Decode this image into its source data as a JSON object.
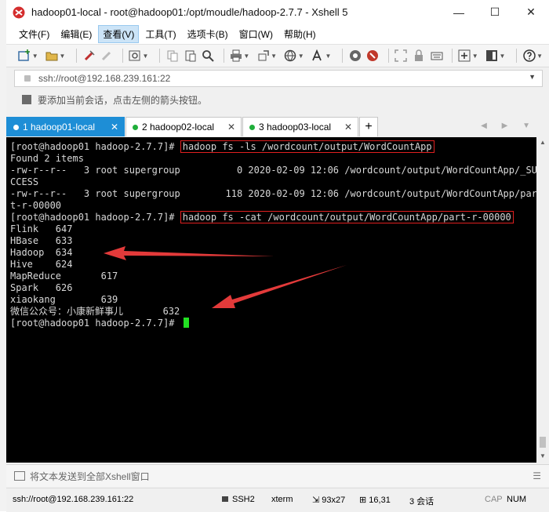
{
  "window": {
    "title": "hadoop01-local - root@hadoop01:/opt/moudle/hadoop-2.7.7 - Xshell 5"
  },
  "menu": [
    "文件(F)",
    "编辑(E)",
    "查看(V)",
    "工具(T)",
    "选项卡(B)",
    "窗口(W)",
    "帮助(H)"
  ],
  "address": {
    "value": "ssh://root@192.168.239.161:22"
  },
  "hint": {
    "text": "要添加当前会话，点击左侧的箭头按钮。"
  },
  "tabs": [
    {
      "label": "1 hadoop01-local",
      "active": true
    },
    {
      "label": "2 hadoop02-local",
      "active": false
    },
    {
      "label": "3 hadoop03-local",
      "active": false
    }
  ],
  "terminal": {
    "lines": [
      {
        "prompt": "[root@hadoop01 hadoop-2.7.7]# ",
        "cmd": "hadoop fs -ls /wordcount/output/WordCountApp"
      },
      {
        "text": "Found 2 items"
      },
      {
        "text": "-rw-r--r--   3 root supergroup          0 2020-02-09 12:06 /wordcount/output/WordCountApp/_SU"
      },
      {
        "text": "CCESS"
      },
      {
        "text": "-rw-r--r--   3 root supergroup        118 2020-02-09 12:06 /wordcount/output/WordCountApp/par"
      },
      {
        "text": "t-r-00000"
      },
      {
        "prompt": "[root@hadoop01 hadoop-2.7.7]# ",
        "cmd": "hadoop fs -cat /wordcount/output/WordCountApp/part-r-00000"
      },
      {
        "text": "Flink   647"
      },
      {
        "text": "HBase   633"
      },
      {
        "text": "Hadoop  634"
      },
      {
        "text": "Hive    624"
      },
      {
        "text": "MapReduce       617"
      },
      {
        "text": "Spark   626"
      },
      {
        "text": "xiaokang        639"
      },
      {
        "text": "微信公众号：小康新鲜事儿       632"
      },
      {
        "prompt": "[root@hadoop01 hadoop-2.7.7]# ",
        "cursor": true
      }
    ]
  },
  "compose": {
    "placeholder": "将文本发送到全部Xshell窗口"
  },
  "status": {
    "connection": "ssh://root@192.168.239.161:22",
    "protocol": "SSH2",
    "terminal_type": "xterm",
    "size": "93x27",
    "position": "16,31",
    "sessions": "3 会话",
    "caps": "CAP",
    "num": "NUM"
  },
  "colors": {
    "terminal_bg": "#000000",
    "terminal_fg": "#d8d8d8",
    "highlight": "#e02020",
    "cursor": "#22e022",
    "tab_active": "#1e8ed6"
  }
}
